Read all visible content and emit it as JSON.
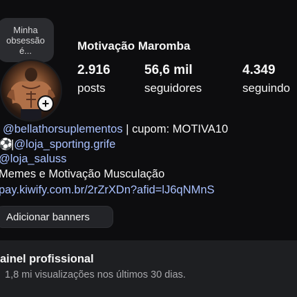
{
  "note": {
    "text": "Minha\nobsessão\né..."
  },
  "profile": {
    "name": "Motivação Maromba"
  },
  "stats": [
    {
      "value": "2.916",
      "label": "posts"
    },
    {
      "value": "56,6 mil",
      "label": "seguidores"
    },
    {
      "value": "4.349",
      "label": "seguindo"
    }
  ],
  "bio": {
    "line1_handle": "@bellathorsuplementos",
    "line1_text": " | cupom: MOTIVA10",
    "line2_sep": "|",
    "line2_handle": "@loja_sporting.grife",
    "line3_handle": "@loja_saluss",
    "line4_text": " Memes e Motivação Musculação",
    "line5_link": "pay.kiwify.com.br/2rZrXDn?afid=lJ6qNMnS"
  },
  "banners_button": {
    "label": "Adicionar banners"
  },
  "professional_panel": {
    "title": "ainel profissional",
    "subtitle": "1,8 mi visualizações nos últimos 30 dias."
  },
  "colors": {
    "link": "#a9c1ff",
    "background": "#0d0d0f",
    "panel": "#1e1f22"
  },
  "icons": {
    "add_story": "plus-icon",
    "soccer": "soccer-ball-icon"
  }
}
